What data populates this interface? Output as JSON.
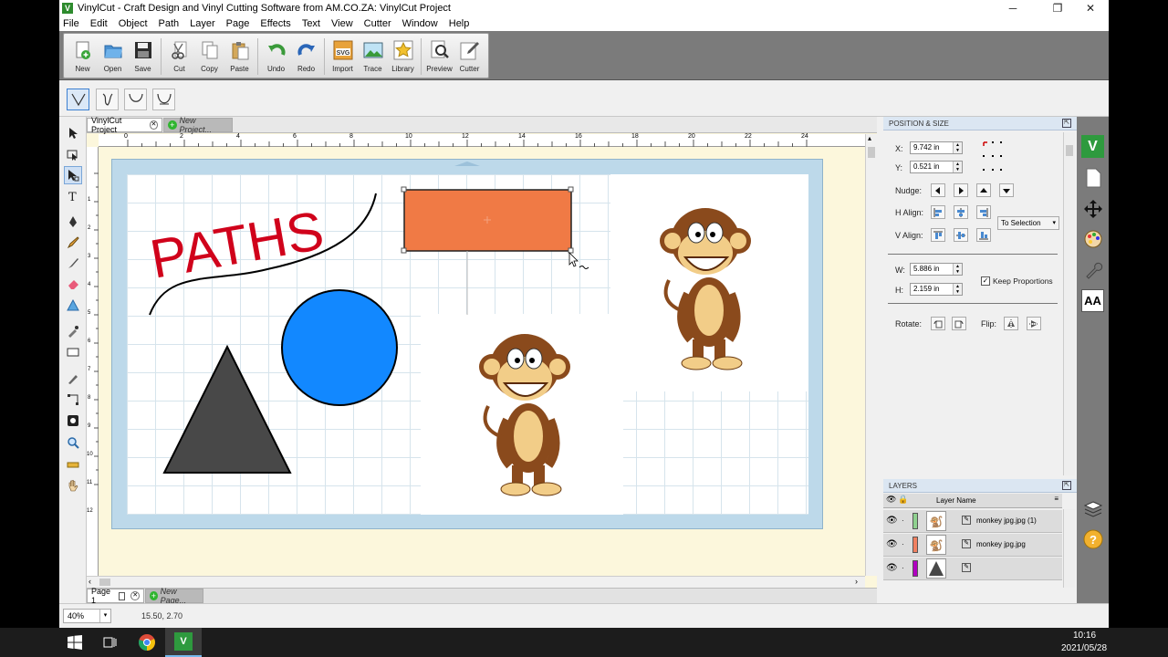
{
  "window": {
    "title": "VinylCut - Craft Design and Vinyl Cutting Software from AM.CO.ZA: VinylCut Project",
    "app_logo": "V",
    "minimize": "─",
    "maximize": "❐",
    "close": "✕"
  },
  "menu": [
    "File",
    "Edit",
    "Object",
    "Path",
    "Layer",
    "Page",
    "Effects",
    "Text",
    "View",
    "Cutter",
    "Window",
    "Help"
  ],
  "toolbar": {
    "buttons": [
      {
        "label": "New",
        "icon": "new-file-icon"
      },
      {
        "label": "Open",
        "icon": "open-folder-icon"
      },
      {
        "label": "Save",
        "icon": "floppy-disk-icon"
      },
      {
        "label": "Cut",
        "icon": "scissors-icon"
      },
      {
        "label": "Copy",
        "icon": "copy-icon"
      },
      {
        "label": "Paste",
        "icon": "paste-icon"
      },
      {
        "label": "Undo",
        "icon": "undo-icon"
      },
      {
        "label": "Redo",
        "icon": "redo-icon"
      },
      {
        "label": "Import",
        "icon": "import-svg-icon"
      },
      {
        "label": "Trace",
        "icon": "trace-icon"
      },
      {
        "label": "Library",
        "icon": "library-icon"
      },
      {
        "label": "Preview",
        "icon": "preview-icon"
      },
      {
        "label": "Cutter",
        "icon": "cutter-icon"
      }
    ],
    "import_badge": "SVG"
  },
  "tabs": {
    "project": "VinylCut Project",
    "new_project": "New Project..."
  },
  "ruler": {
    "h_labels": [
      "0",
      "2",
      "4",
      "6",
      "8",
      "10",
      "12",
      "14",
      "16",
      "18",
      "20",
      "22",
      "24"
    ],
    "v_labels": [
      "1",
      "2",
      "3",
      "4",
      "5",
      "6",
      "7",
      "8",
      "9",
      "10",
      "11",
      "12"
    ]
  },
  "canvas": {
    "paths_text": "PATHS",
    "colors": {
      "text_red": "#d0021b",
      "rectangle": "#f07a45",
      "circle": "#1288ff",
      "triangle": "#484848"
    }
  },
  "pagetabs": {
    "page1": "Page 1",
    "new_page": "New Page..."
  },
  "status": {
    "zoom": "40%",
    "coords": "15.50, 2.70"
  },
  "position_size": {
    "title": "POSITION & SIZE",
    "x_label": "X:",
    "x_value": "9.742 in",
    "y_label": "Y:",
    "y_value": "0.521 in",
    "nudge_label": "Nudge:",
    "halign_label": "H Align:",
    "valign_label": "V Align:",
    "align_to": "To Selection",
    "w_label": "W:",
    "w_value": "5.886 in",
    "h_label": "H:",
    "h_value": "2.159 in",
    "keep_proportions": "Keep Proportions",
    "rotate_label": "Rotate:",
    "flip_label": "Flip:"
  },
  "layers": {
    "title": "LAYERS",
    "column": "Layer Name",
    "rows": [
      {
        "name": "monkey jpg.jpg (1)",
        "color": "#8fd18f"
      },
      {
        "name": "monkey jpg.jpg",
        "color": "#f08060"
      },
      {
        "name": "",
        "color": "#b000c0"
      }
    ]
  },
  "taskbar": {
    "time": "10:16",
    "date": "2021/05/28"
  }
}
